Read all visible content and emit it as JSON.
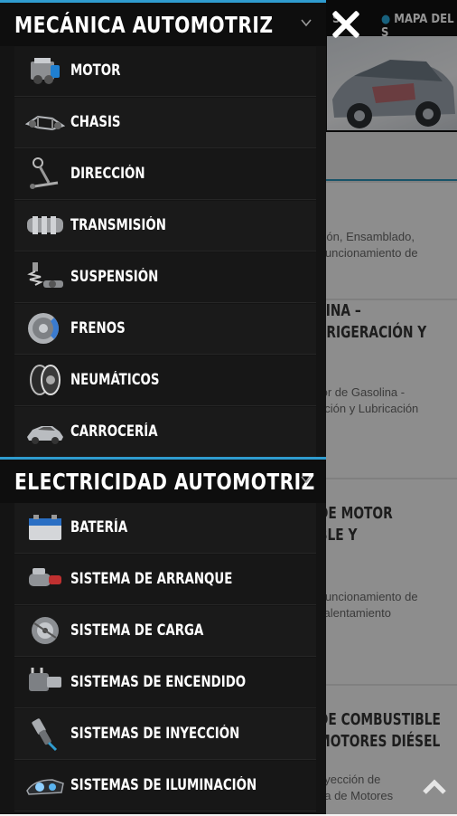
{
  "background": {
    "nav": [
      "S",
      "MAPA DEL S"
    ],
    "cards": [
      {
        "title_lines": [],
        "desc_lines": [
          "ción, Ensamblado,",
          "Funcionamiento de"
        ]
      },
      {
        "title_lines": [
          "LINA –",
          "FRIGERACIÓN Y"
        ],
        "desc_lines": [
          "tor de Gasolina -",
          "ación y Lubricación"
        ]
      },
      {
        "title_lines": [
          "DE MOTOR",
          "BLE Y"
        ],
        "desc_lines": [
          "Funcionamiento de",
          "calentamiento"
        ]
      },
      {
        "title_lines": [
          "DE COMBUSTIBLE",
          "MOTORES DIÉSEL"
        ],
        "desc_lines": [
          "nyección de",
          "ea de Motores"
        ]
      }
    ]
  },
  "drawer": {
    "sections": [
      {
        "title": "MECÁNICA AUTOMOTRIZ",
        "items": [
          {
            "label": "MOTOR",
            "icon": "engine-icon"
          },
          {
            "label": "CHASIS",
            "icon": "chassis-icon"
          },
          {
            "label": "DIRECCIÓN",
            "icon": "steering-icon"
          },
          {
            "label": "TRANSMISIÓN",
            "icon": "transmission-icon"
          },
          {
            "label": "SUSPENSIÓN",
            "icon": "suspension-icon"
          },
          {
            "label": "FRENOS",
            "icon": "brake-disc-icon"
          },
          {
            "label": "NEUMÁTICOS",
            "icon": "tire-icon"
          },
          {
            "label": "CARROCERÍA",
            "icon": "car-body-icon"
          }
        ]
      },
      {
        "title": "ELECTRICIDAD AUTOMOTRIZ",
        "items": [
          {
            "label": "BATERÍA",
            "icon": "battery-icon"
          },
          {
            "label": "SISTEMA DE ARRANQUE",
            "icon": "starter-motor-icon"
          },
          {
            "label": "SISTEMA DE CARGA",
            "icon": "alternator-icon"
          },
          {
            "label": "SISTEMAS DE ENCENDIDO",
            "icon": "ignition-coil-icon"
          },
          {
            "label": "SISTEMAS DE INYECCIÓN",
            "icon": "injector-icon"
          },
          {
            "label": "SISTEMAS DE ILUMINACIÓN",
            "icon": "headlight-icon"
          }
        ]
      }
    ]
  },
  "colors": {
    "accent": "#2f9ccf",
    "drawer_bg": "#141414"
  }
}
